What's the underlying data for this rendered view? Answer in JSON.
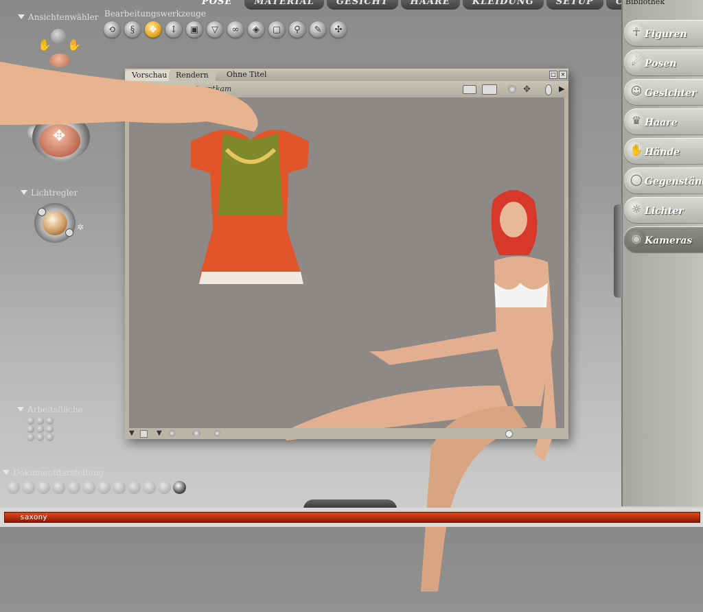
{
  "top_tabs": [
    "POSE",
    "MATERIAL",
    "GESICHT",
    "HAARE",
    "KLEIDUNG",
    "SETUP",
    "CONTENT"
  ],
  "active_tab": "POSE",
  "left_panel": {
    "camera_controls_label": "Ansichtenwähler",
    "light_controls_label": "Lichtregler",
    "ui_dots_label": "Arbeitsfläche",
    "document_style_label": "Dokumentdarstellung"
  },
  "toolbar": {
    "label": "Bearbeitungswerkzeuge",
    "tools": [
      "rotate",
      "twist",
      "translate",
      "move-vertical",
      "scale",
      "taper",
      "chain",
      "color",
      "grouping",
      "view-magnifier",
      "morph",
      "direct-manipulation"
    ],
    "active_index": 2
  },
  "document": {
    "tabs": [
      "Vorschau",
      "Rendern"
    ],
    "title": "Ohne Titel",
    "camera_select": "Hauptkam"
  },
  "library": {
    "title": "Bibliothek",
    "items": [
      {
        "label": "Figuren",
        "icon": "figure-icon"
      },
      {
        "label": "Posen",
        "icon": "pose-icon"
      },
      {
        "label": "Gesichter",
        "icon": "face-icon"
      },
      {
        "label": "Haare",
        "icon": "hair-icon"
      },
      {
        "label": "Hände",
        "icon": "hand-icon"
      },
      {
        "label": "Gegenstände",
        "icon": "prop-icon"
      },
      {
        "label": "Lichter",
        "icon": "light-icon"
      },
      {
        "label": "Kameras",
        "icon": "camera-icon"
      }
    ],
    "active_index": 7
  },
  "status": {
    "text": "saxony"
  },
  "colors": {
    "accent": "#e8a81e",
    "status_bar": "#c0300e"
  }
}
